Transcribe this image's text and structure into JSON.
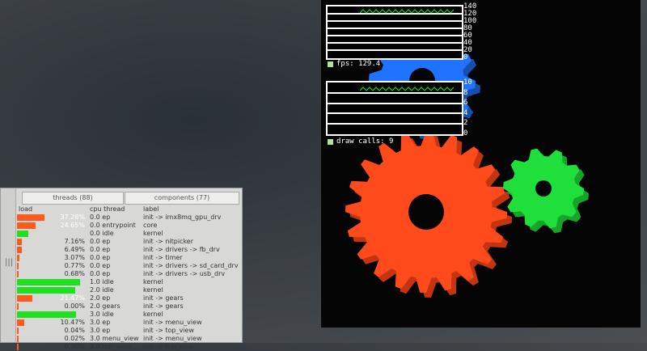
{
  "top_view": {
    "tabs": [
      {
        "label": "threads (88)"
      },
      {
        "label": "components (77)"
      }
    ],
    "columns": {
      "load": "load",
      "cpu_thread": "cpu thread",
      "label": "label"
    },
    "rows": [
      {
        "load": "37.28%",
        "cpu_thread": "0.0 ep",
        "label": "init -> imx8mq_gpu_drv",
        "bar_color": "#ff5a1e",
        "bar_fraction": 0.37
      },
      {
        "load": "24.65%",
        "cpu_thread": "0.0 entrypoint",
        "label": "core",
        "bar_color": "#ff5a1e",
        "bar_fraction": 0.25
      },
      {
        "load": "",
        "cpu_thread": "0.0 idle",
        "label": "kernel",
        "bar_color": "#1ee01e",
        "bar_fraction": 0.15
      },
      {
        "load": "7.16%",
        "cpu_thread": "0.0 ep",
        "label": "init -> nitpicker",
        "bar_color": "#ff5a1e",
        "bar_fraction": 0.07
      },
      {
        "load": "6.49%",
        "cpu_thread": "0.0 ep",
        "label": "init -> drivers -> fb_drv",
        "bar_color": "#ff5a1e",
        "bar_fraction": 0.06
      },
      {
        "load": "3.07%",
        "cpu_thread": "0.0 ep",
        "label": "init -> timer",
        "bar_color": "#ff5a1e",
        "bar_fraction": 0.03
      },
      {
        "load": "0.77%",
        "cpu_thread": "0.0 ep",
        "label": "init -> drivers -> sd_card_drv",
        "bar_color": "#ff5a1e",
        "bar_fraction": 0.01
      },
      {
        "load": "0.68%",
        "cpu_thread": "0.0 ep",
        "label": "init -> drivers -> usb_drv",
        "bar_color": "#ff5a1e",
        "bar_fraction": 0.01
      },
      {
        "load": "",
        "cpu_thread": "1.0 idle",
        "label": "kernel",
        "bar_color": "#1ee01e",
        "bar_fraction": 0.85
      },
      {
        "load": "",
        "cpu_thread": "2.0 idle",
        "label": "kernel",
        "bar_color": "#1ee01e",
        "bar_fraction": 0.78
      },
      {
        "load": "21.47%",
        "cpu_thread": "2.0 ep",
        "label": "init -> gears",
        "bar_color": "#ff5a1e",
        "bar_fraction": 0.21
      },
      {
        "load": "0.00%",
        "cpu_thread": "2.0 gears",
        "label": "init -> gears",
        "bar_color": "#ff5a1e",
        "bar_fraction": 0.0
      },
      {
        "load": "",
        "cpu_thread": "3.0 idle",
        "label": "kernel",
        "bar_color": "#1ee01e",
        "bar_fraction": 0.79
      },
      {
        "load": "10.47%",
        "cpu_thread": "3.0 ep",
        "label": "init -> menu_view",
        "bar_color": "#ff5a1e",
        "bar_fraction": 0.1
      },
      {
        "load": "0.04%",
        "cpu_thread": "3.0 ep",
        "label": "init -> top_view",
        "bar_color": "#ff5a1e",
        "bar_fraction": 0.0
      },
      {
        "load": "0.02%",
        "cpu_thread": "3.0 menu_view",
        "label": "init -> menu_view",
        "bar_color": "#ff5a1e",
        "bar_fraction": 0.0
      },
      {
        "load": "0.00%",
        "cpu_thread": "3.0 top_view",
        "label": "init -> top_view",
        "bar_color": "#ff5a1e",
        "bar_fraction": 0.0
      }
    ]
  },
  "fps_graph": {
    "caption": "fps: 129.4",
    "ticks": [
      "140",
      "120",
      "100",
      "80",
      "60",
      "40",
      "20",
      "0"
    ]
  },
  "draw_calls_graph": {
    "caption": "draw calls: 9",
    "ticks": [
      "10",
      "8",
      "6",
      "4",
      "2",
      "0"
    ]
  },
  "gears": {
    "red": "#ff4b1c",
    "green": "#1fe03a",
    "blue": "#1f73ff"
  }
}
